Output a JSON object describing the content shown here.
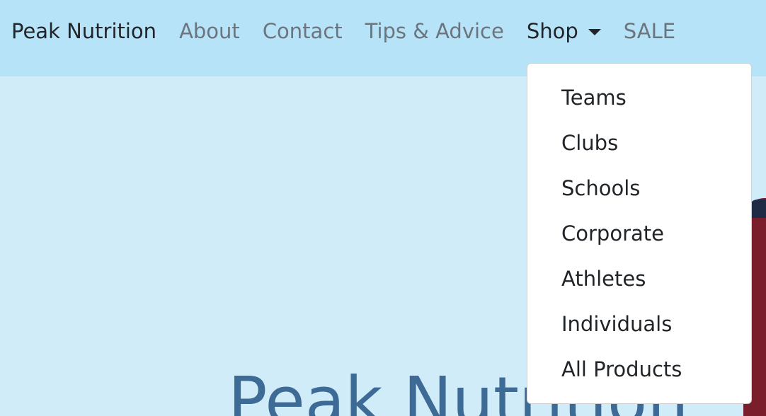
{
  "navbar": {
    "brand": "Peak Nutrition",
    "links": [
      {
        "label": "About"
      },
      {
        "label": "Contact"
      },
      {
        "label": "Tips & Advice"
      },
      {
        "label": "Shop"
      },
      {
        "label": "SALE"
      }
    ]
  },
  "dropdown": {
    "items": [
      {
        "label": "Teams"
      },
      {
        "label": "Clubs"
      },
      {
        "label": "Schools"
      },
      {
        "label": "Corporate"
      },
      {
        "label": "Athletes"
      },
      {
        "label": "Individuals"
      },
      {
        "label": "All Products"
      }
    ]
  },
  "hero": {
    "title": "Peak Nutrition"
  },
  "colors": {
    "navbar_bg": "#b7e3f8",
    "page_bg": "#d1ecf9",
    "hero_title": "#3e6a96",
    "link_muted": "#6c757d",
    "link_active": "#212529"
  }
}
